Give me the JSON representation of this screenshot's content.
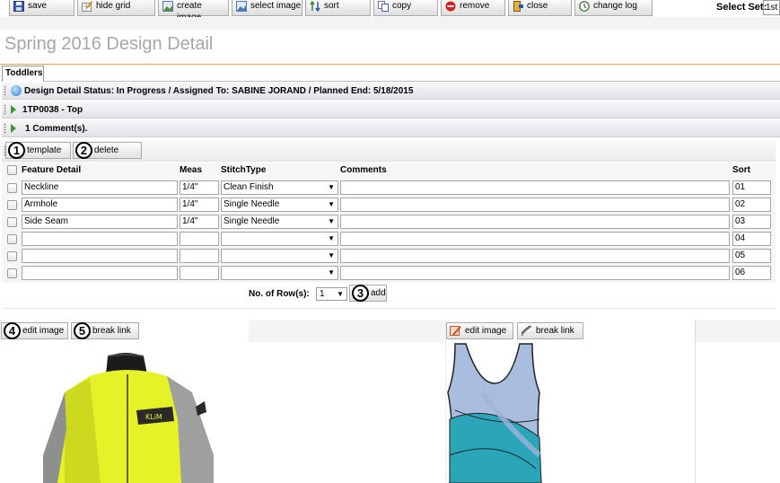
{
  "toolbar": {
    "save": "save",
    "hide_grid": "hide grid",
    "create_image": "create image",
    "select_image": "select image",
    "sort": "sort",
    "copy": "copy",
    "remove": "remove",
    "close": "close",
    "change_log": "change log",
    "select_set_label": "Select Set:",
    "select_set_value": "1st"
  },
  "page_title": "Spring 2016 Design Detail",
  "tab": "Toddlers",
  "sections": {
    "design_detail": "Design Detail  Status: In Progress / Assigned To: SABINE JORAND / Planned End: 5/18/2015",
    "item": "1TP0038 - Top",
    "comments": "1 Comment(s)."
  },
  "actions": {
    "template_num": "1",
    "template": "template",
    "delete_num": "2",
    "delete": "delete"
  },
  "grid": {
    "headers": {
      "feature": "Feature Detail",
      "meas": "Meas",
      "stitch": "StitchType",
      "comments": "Comments",
      "sort": "Sort"
    },
    "rows": [
      {
        "feature": "Neckline",
        "meas": "1/4\"",
        "stitch": "Clean Finish",
        "comment": "",
        "sort": "01"
      },
      {
        "feature": "Armhole",
        "meas": "1/4\"",
        "stitch": "Single Needle",
        "comment": "",
        "sort": "02"
      },
      {
        "feature": "Side Seam",
        "meas": "1/4\"",
        "stitch": "Single Needle",
        "comment": "",
        "sort": "03"
      },
      {
        "feature": "",
        "meas": "",
        "stitch": "",
        "comment": "",
        "sort": "04"
      },
      {
        "feature": "",
        "meas": "",
        "stitch": "",
        "comment": "",
        "sort": "05"
      },
      {
        "feature": "",
        "meas": "",
        "stitch": "",
        "comment": "",
        "sort": "06"
      }
    ]
  },
  "rows_control": {
    "label": "No. of Row(s):",
    "value": "1",
    "add_num": "3",
    "add": "add"
  },
  "images": {
    "left": {
      "edit_num": "4",
      "edit": "edit image",
      "break_num": "5",
      "break": "break link"
    },
    "right": {
      "edit": "edit image",
      "break": "break link"
    }
  },
  "colors": {
    "title": "#a7a7a7",
    "accent_line": "#e3a43a",
    "jacket": "#e4f227",
    "tank_teal": "#2aa6b8"
  }
}
